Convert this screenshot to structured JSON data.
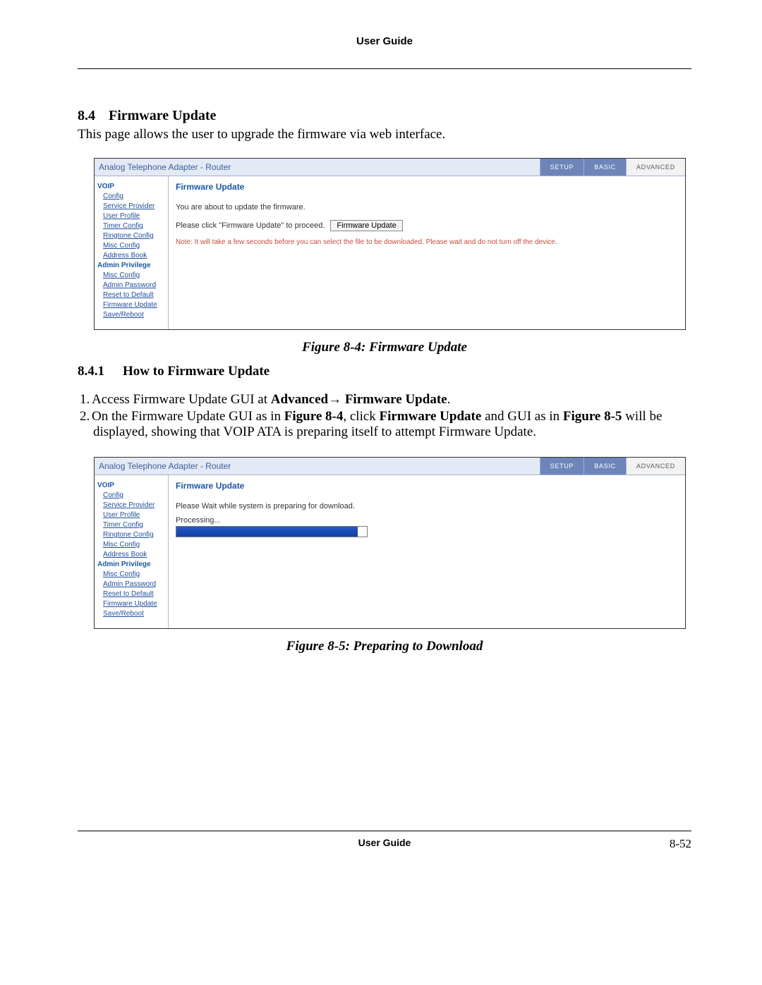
{
  "header_title": "User Guide",
  "section": {
    "number": "8.4",
    "title": "Firmware Update"
  },
  "intro_text": "This page allows the user to upgrade the firmware via web interface.",
  "caption1": "Figure 8-4: Firmware Update",
  "subsection": {
    "number": "8.4.1",
    "title": "How to Firmware Update"
  },
  "step1_pre": "Access Firmware Update GUI at ",
  "step1_bold": "Advanced→ Firmware Update",
  "step1_post": ".",
  "step2_a": "On the Firmware Update GUI as in ",
  "step2_fig_a": "Figure 8-4",
  "step2_b": ", click ",
  "step2_btn": "Firmware Update",
  "step2_c": " and GUI as in ",
  "step2_fig_b": "Figure 8-5",
  "step2_d": " will be displayed, showing that VOIP ATA is preparing itself to attempt Firmware Update.",
  "caption2": "Figure 8-5: Preparing to Download",
  "footer_center": "User Guide",
  "footer_right": "8-52",
  "gui": {
    "window_title": "Analog Telephone Adapter - Router",
    "tabs": {
      "setup": "SETUP",
      "basic": "BASIC",
      "advanced": "ADVANCED"
    },
    "nav": {
      "voip": "VOIP",
      "config": "Config",
      "service_provider": "Service Provider",
      "user_profile": "User Profile",
      "timer_config": "Timer Config",
      "ringtone_config": "Ringtone Config",
      "misc_config": "Misc Config",
      "address_book": "Address Book",
      "admin_priv": "Admin Privilege",
      "misc_config2": "Misc Config",
      "admin_password": "Admin Password",
      "reset_default": "Reset to Default",
      "firmware_update": "Firmware Update",
      "save_reboot": "Save/Reboot"
    },
    "content1": {
      "title": "Firmware Update",
      "line1": "You are about to update the firmware.",
      "proceed_text": "Please click \"Firmware Update\" to proceed.",
      "button_label": "Firmware Update",
      "note": "Note: It will take a few seconds before you can select the file to be downloaded. Please wait and do not turn off the device."
    },
    "content2": {
      "title": "Firmware Update",
      "line1": "Please Wait while system is preparing for download.",
      "processing": "Processing..."
    }
  }
}
